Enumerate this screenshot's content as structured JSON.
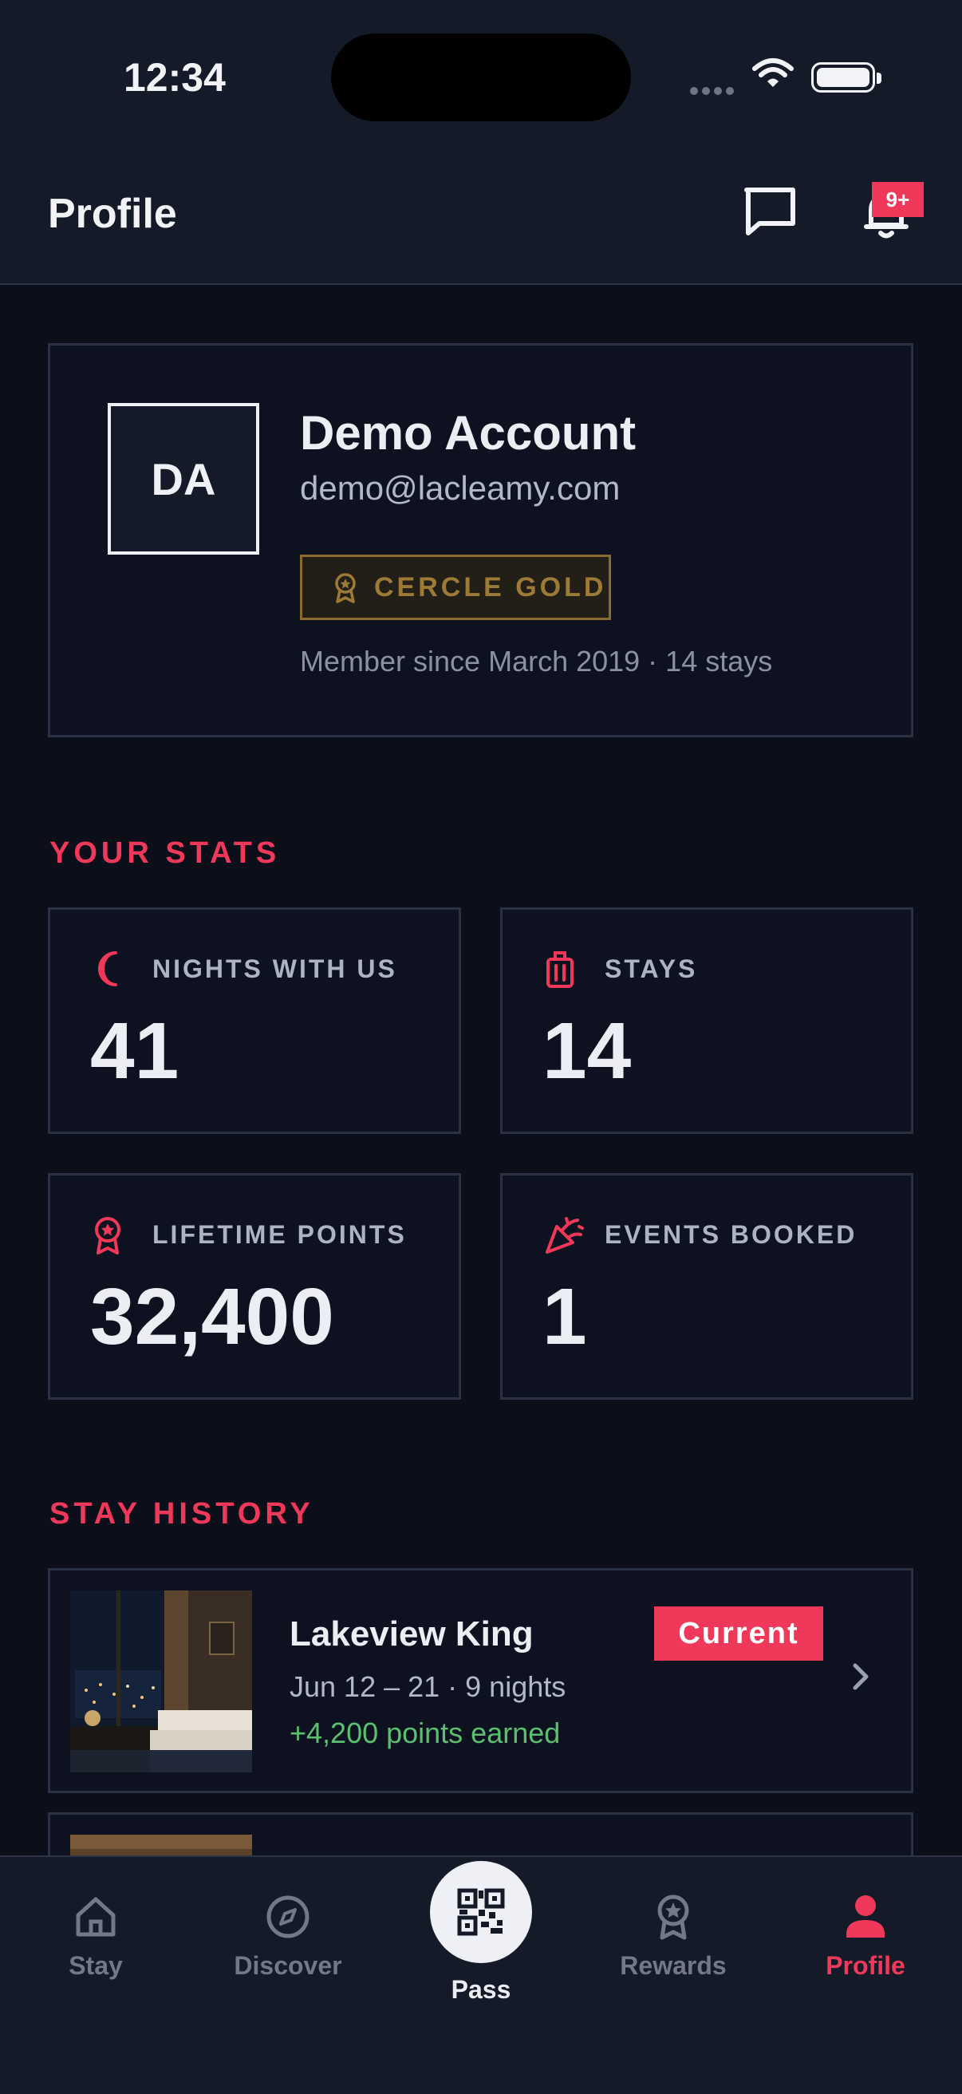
{
  "status_bar": {
    "time": "12:34"
  },
  "header": {
    "title": "Profile",
    "notification_badge": "9+"
  },
  "profile": {
    "initials": "DA",
    "name": "Demo Account",
    "email": "demo@lacleamy.com",
    "tier": "CERCLE GOLD",
    "member_since": "Member since March 2019 · 14 stays"
  },
  "stats": {
    "heading": "YOUR STATS",
    "items": [
      {
        "label": "NIGHTS WITH US",
        "value": "41",
        "icon": "moon-icon"
      },
      {
        "label": "STAYS",
        "value": "14",
        "icon": "luggage-icon"
      },
      {
        "label": "LIFETIME POINTS",
        "value": "32,400",
        "icon": "award-icon"
      },
      {
        "label": "EVENTS BOOKED",
        "value": "1",
        "icon": "party-popper-icon"
      }
    ]
  },
  "history": {
    "heading": "STAY HISTORY",
    "items": [
      {
        "room": "Lakeview King",
        "dates": "Jun 12 – 21 · 9 nights",
        "points": "+4,200 points earned",
        "status": "Current"
      }
    ]
  },
  "nav": {
    "items": [
      {
        "label": "Stay",
        "icon": "home-icon"
      },
      {
        "label": "Discover",
        "icon": "compass-icon"
      },
      {
        "label": "Pass",
        "icon": "qr-code-icon"
      },
      {
        "label": "Rewards",
        "icon": "award-icon"
      },
      {
        "label": "Profile",
        "icon": "user-icon",
        "active": true
      }
    ]
  },
  "colors": {
    "accent": "#f0395a",
    "gold": "#9d7a35",
    "success": "#5bbf70",
    "background": "#0c0f1a"
  }
}
